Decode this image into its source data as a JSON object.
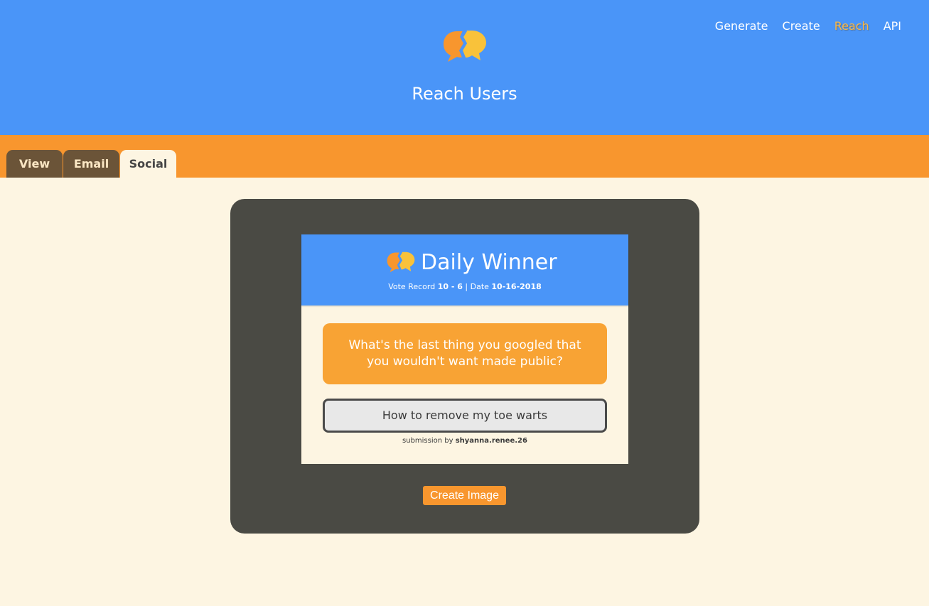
{
  "header": {
    "title": "Reach Users",
    "logo_icon": "speech-bubbles-logo-icon"
  },
  "nav": {
    "items": [
      {
        "label": "Generate",
        "active": false
      },
      {
        "label": "Create",
        "active": false
      },
      {
        "label": "Reach",
        "active": true
      },
      {
        "label": "API",
        "active": false
      }
    ]
  },
  "tabs": [
    {
      "label": "View",
      "selected": false
    },
    {
      "label": "Email",
      "selected": false
    },
    {
      "label": "Social",
      "selected": true
    }
  ],
  "card": {
    "title": "Daily Winner",
    "vote_record_label": "Vote Record",
    "vote_record_value": "10 - 6",
    "separator": "|",
    "date_label": "Date",
    "date_value": "10-16-2018",
    "question": "What's the last thing you googled that you wouldn't want made public?",
    "answer": "How to remove my toe warts",
    "submission_prefix": "submission by",
    "submission_user": "shyanna.renee.26"
  },
  "actions": {
    "create_image_label": "Create Image"
  },
  "colors": {
    "header_blue": "#4a95f8",
    "tabbar_orange": "#f8962e",
    "page_cream": "#fdf5e2",
    "panel_dark": "#4a4a44",
    "tab_brown": "#6b5438",
    "question_orange": "#f8a334",
    "nav_active": "#f7b84a"
  }
}
